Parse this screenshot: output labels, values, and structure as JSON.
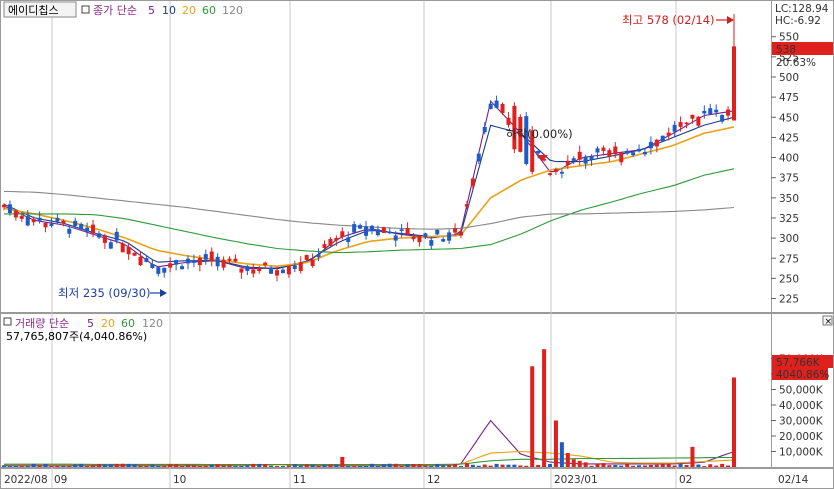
{
  "price_header": {
    "name": "에이디칩스",
    "ma_label": "종가 단순",
    "ma_periods": [
      "5",
      "10",
      "20",
      "60",
      "120"
    ],
    "lc": "LC:128.94",
    "hc": "HC:-6.92"
  },
  "price_axis": {
    "ticks": [
      "550",
      "525",
      "500",
      "475",
      "450",
      "425",
      "400",
      "375",
      "350",
      "325",
      "300",
      "275",
      "250",
      "225"
    ],
    "current_price": "538",
    "current_change": "20.63%"
  },
  "annotations": {
    "high": "최고 578 (02/14)",
    "low": "최저 235 (09/30)",
    "mid": "하락(0.00%)"
  },
  "volume_header": {
    "title": "거래량 단순",
    "ma_periods": [
      "5",
      "20",
      "60",
      "120"
    ],
    "info": "57,765,807주(4,040.86%)"
  },
  "volume_axis": {
    "ticks": [
      "70,000K",
      "60,000K",
      "50,000K",
      "40,000K",
      "30,000K",
      "20,000K",
      "10,000K"
    ],
    "current_volume": "57,766K",
    "current_pct": "4040.86%"
  },
  "x_axis": {
    "labels": [
      "2022/08",
      "09",
      "10",
      "11",
      "12",
      "2023/01",
      "02",
      "02/14"
    ]
  },
  "colors": {
    "up": "#e0201c",
    "down": "#1d5bc7",
    "ma5": "#7a1e8c",
    "ma10": "#1a3a8c",
    "ma20": "#e8a317",
    "ma60": "#2e9a3a",
    "ma120": "#888888"
  },
  "chart_data": [
    {
      "type": "candlestick",
      "title": "에이디칩스",
      "ylim": [
        212,
        572
      ],
      "x": [
        "2022/08",
        "09",
        "10",
        "11",
        "12",
        "2023/01",
        "02",
        "02/14"
      ],
      "annotations": {
        "high": {
          "value": 578,
          "date": "02/14"
        },
        "low": {
          "value": 235,
          "date": "09/30"
        }
      },
      "last": {
        "price": 538,
        "change_pct": 20.63
      },
      "series": [
        {
          "name": "5",
          "trend": [
            340,
            322,
            316,
            304,
            292,
            264,
            270,
            272,
            262,
            263,
            270,
            300,
            312,
            305,
            300,
            305,
            470,
            430,
            380,
            400,
            405,
            410,
            430,
            452,
            458
          ]
        },
        {
          "name": "10",
          "trend": [
            342,
            325,
            318,
            306,
            296,
            270,
            272,
            272,
            264,
            262,
            272,
            295,
            310,
            306,
            302,
            303,
            440,
            430,
            395,
            395,
            402,
            410,
            425,
            440,
            450
          ]
        },
        {
          "name": "20",
          "trend": [
            337,
            330,
            322,
            312,
            300,
            285,
            278,
            273,
            268,
            265,
            270,
            285,
            296,
            300,
            302,
            303,
            350,
            372,
            385,
            390,
            395,
            405,
            415,
            430,
            438
          ]
        },
        {
          "name": "60",
          "trend": [
            330,
            330,
            330,
            329,
            324,
            316,
            308,
            300,
            293,
            287,
            284,
            282,
            283,
            285,
            286,
            287,
            292,
            305,
            322,
            335,
            345,
            356,
            365,
            378,
            386
          ]
        },
        {
          "name": "120",
          "trend": [
            358,
            357,
            354,
            350,
            346,
            342,
            338,
            333,
            328,
            323,
            319,
            316,
            314,
            312,
            311,
            312,
            318,
            326,
            330,
            330,
            331,
            332,
            333,
            335,
            338
          ]
        }
      ]
    },
    {
      "type": "bar",
      "title": "거래량",
      "ylim": [
        0,
        80000
      ],
      "unit": "K",
      "last": {
        "volume": 57766,
        "change_pct": 4040.86
      },
      "series": [
        {
          "name": "5",
          "trend": [
            800,
            800,
            800,
            800,
            800,
            800,
            800,
            800,
            900,
            1500,
            800,
            800,
            800,
            800,
            800,
            1500,
            30000,
            8000,
            3000,
            2000,
            2000,
            2000,
            2000,
            3000,
            10000
          ]
        },
        {
          "name": "20",
          "trend": [
            1500,
            1500,
            1400,
            1400,
            1400,
            1300,
            1300,
            1200,
            1200,
            1300,
            1300,
            1300,
            1300,
            1300,
            1200,
            1800,
            9000,
            10000,
            9000,
            7000,
            3000,
            2500,
            2500,
            3500,
            4500
          ]
        },
        {
          "name": "60",
          "trend": [
            1800,
            1800,
            1800,
            1700,
            1700,
            1700,
            1700,
            1600,
            1600,
            1600,
            1600,
            1600,
            1600,
            1600,
            1600,
            1800,
            4000,
            5000,
            5000,
            5500,
            5500,
            5600,
            5800,
            6000,
            6200
          ]
        }
      ]
    }
  ]
}
